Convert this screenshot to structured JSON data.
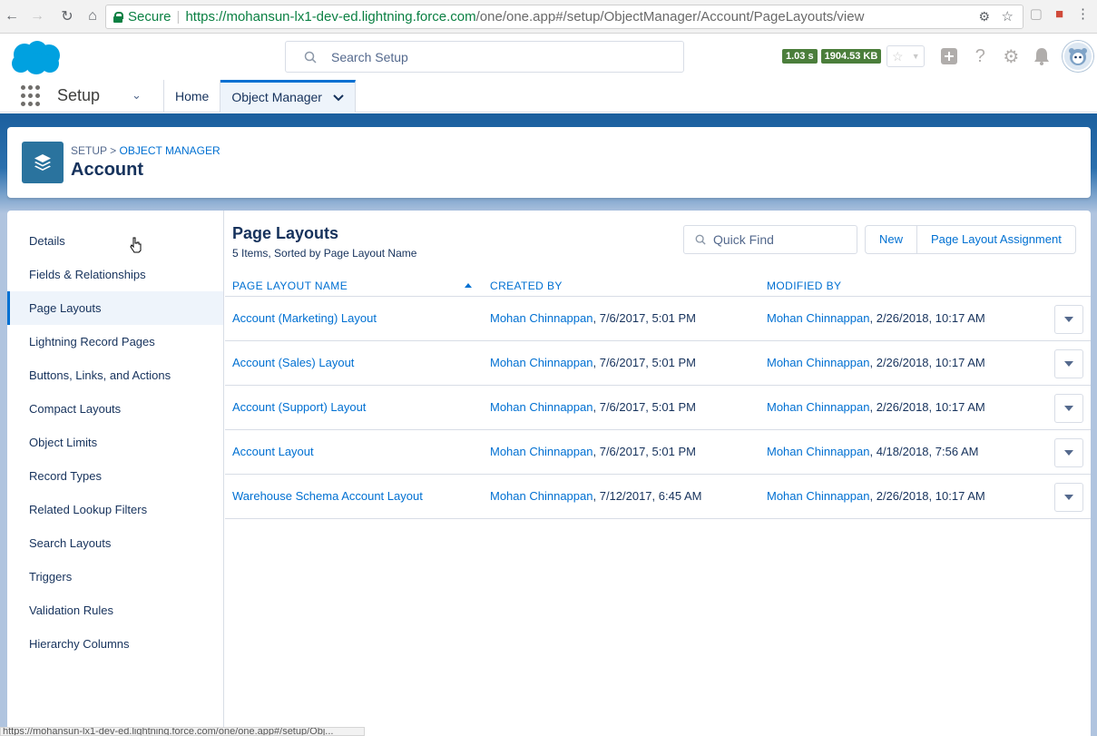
{
  "browser": {
    "secure_label": "Secure",
    "url_scheme": "https://",
    "url_host": "mohansun-lx1-dev-ed.lightning.force.com",
    "url_path": "/one/one.app#/setup/ObjectManager/Account/PageLayouts/view",
    "status_url": "https://mohansun-lx1-dev-ed.lightning.force.com/one/one.app#/setup/Obj..."
  },
  "header": {
    "search_placeholder": "Search Setup",
    "time_badge": "1.03 s",
    "size_badge": "1904.53 KB"
  },
  "appnav": {
    "app_name": "Setup",
    "tabs": [
      {
        "label": "Home"
      },
      {
        "label": "Object Manager"
      }
    ]
  },
  "page_header": {
    "crumb_setup": "SETUP",
    "crumb_sep": ">",
    "crumb_object_manager": "OBJECT MANAGER",
    "title": "Account"
  },
  "sidebar": {
    "items": [
      {
        "label": "Details"
      },
      {
        "label": "Fields & Relationships"
      },
      {
        "label": "Page Layouts"
      },
      {
        "label": "Lightning Record Pages"
      },
      {
        "label": "Buttons, Links, and Actions"
      },
      {
        "label": "Compact Layouts"
      },
      {
        "label": "Object Limits"
      },
      {
        "label": "Record Types"
      },
      {
        "label": "Related Lookup Filters"
      },
      {
        "label": "Search Layouts"
      },
      {
        "label": "Triggers"
      },
      {
        "label": "Validation Rules"
      },
      {
        "label": "Hierarchy Columns"
      }
    ]
  },
  "content": {
    "title": "Page Layouts",
    "subtitle": "5 Items, Sorted by Page Layout Name",
    "quick_find_placeholder": "Quick Find",
    "new_button": "New",
    "assignment_button": "Page Layout Assignment",
    "columns": [
      "PAGE LAYOUT NAME",
      "CREATED BY",
      "MODIFIED BY"
    ],
    "rows": [
      {
        "name": "Account (Marketing) Layout",
        "created_by": "Mohan Chinnappan",
        "created_at": ", 7/6/2017, 5:01 PM",
        "modified_by": "Mohan Chinnappan",
        "modified_at": ", 2/26/2018, 10:17 AM"
      },
      {
        "name": "Account (Sales) Layout",
        "created_by": "Mohan Chinnappan",
        "created_at": ", 7/6/2017, 5:01 PM",
        "modified_by": "Mohan Chinnappan",
        "modified_at": ", 2/26/2018, 10:17 AM"
      },
      {
        "name": "Account (Support) Layout",
        "created_by": "Mohan Chinnappan",
        "created_at": ", 7/6/2017, 5:01 PM",
        "modified_by": "Mohan Chinnappan",
        "modified_at": ", 2/26/2018, 10:17 AM"
      },
      {
        "name": "Account Layout",
        "created_by": "Mohan Chinnappan",
        "created_at": ", 7/6/2017, 5:01 PM",
        "modified_by": "Mohan Chinnappan",
        "modified_at": ", 4/18/2018, 7:56 AM"
      },
      {
        "name": "Warehouse Schema Account Layout",
        "created_by": "Mohan Chinnappan",
        "created_at": ", 7/12/2017, 6:45 AM",
        "modified_by": "Mohan Chinnappan",
        "modified_at": ", 2/26/2018, 10:17 AM"
      }
    ]
  }
}
